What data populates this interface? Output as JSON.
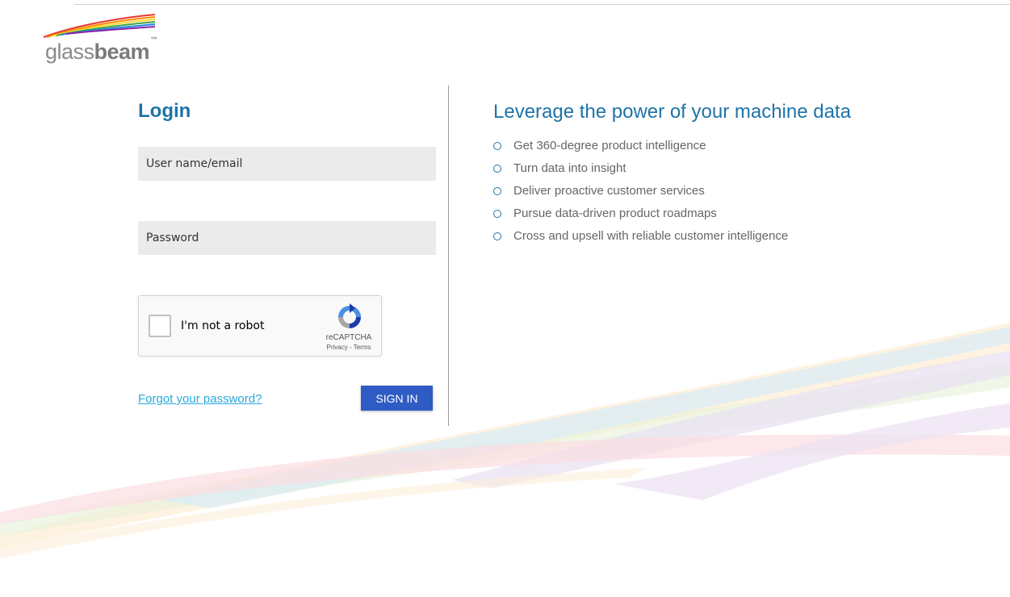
{
  "logo": {
    "light": "glass",
    "bold": "beam",
    "tm": "™"
  },
  "login": {
    "title": "Login",
    "username_placeholder": "User name/email",
    "password_placeholder": "Password",
    "forgot_link": "Forgot your password?",
    "signin_label": "SIGN IN"
  },
  "captcha": {
    "label": "I'm not a robot",
    "brand": "reCAPTCHA",
    "privacy": "Privacy",
    "separator": " - ",
    "terms": "Terms"
  },
  "marketing": {
    "headline": "Leverage the power of your machine data",
    "features": [
      "Get 360-degree product intelligence",
      "Turn data into insight",
      "Deliver proactive customer services",
      "Pursue data-driven product roadmaps",
      "Cross and upsell with reliable customer intelligence"
    ]
  },
  "colors": {
    "accent_blue": "#1e73a8",
    "button_blue": "#2f5cc4",
    "link_blue": "#29a9e0",
    "field_bg": "#ebebeb"
  }
}
